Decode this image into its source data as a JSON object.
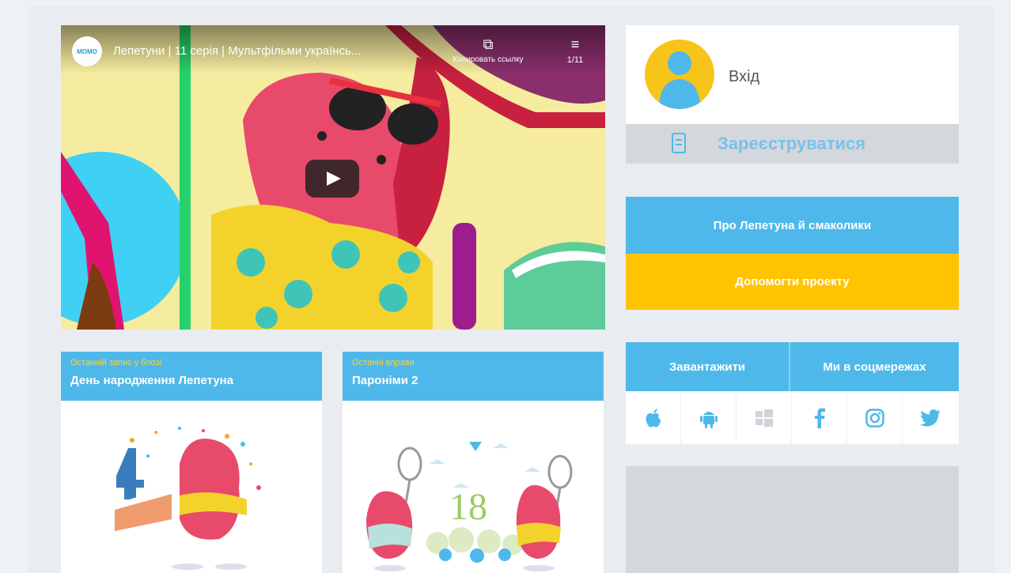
{
  "video": {
    "channel_logo_text": "MOMO",
    "title": "Лепетуни | 11 серія | Мультфільми українсь...",
    "copy_link_label": "Копировать ссылку",
    "playlist_counter": "1/11"
  },
  "cards": [
    {
      "category": "Останній запис у блозі",
      "title": "День народження Лепетуна"
    },
    {
      "category": "Останні вправи",
      "title": "Пароніми 2"
    }
  ],
  "login": {
    "label": "Вхід"
  },
  "register": {
    "label": "Зареєструватися"
  },
  "buttons": {
    "about": "Про Лепетуна й смаколики",
    "help": "Допомогти проекту"
  },
  "links": {
    "download_label": "Завантажити",
    "social_label": "Ми в соцмережах",
    "icons": [
      "apple-icon",
      "android-icon",
      "windows-icon",
      "facebook-icon",
      "instagram-icon",
      "twitter-icon"
    ]
  },
  "colors": {
    "accent_blue": "#4fb8ea",
    "accent_yellow": "#ffc400",
    "gray_block": "#d4d7dc"
  }
}
